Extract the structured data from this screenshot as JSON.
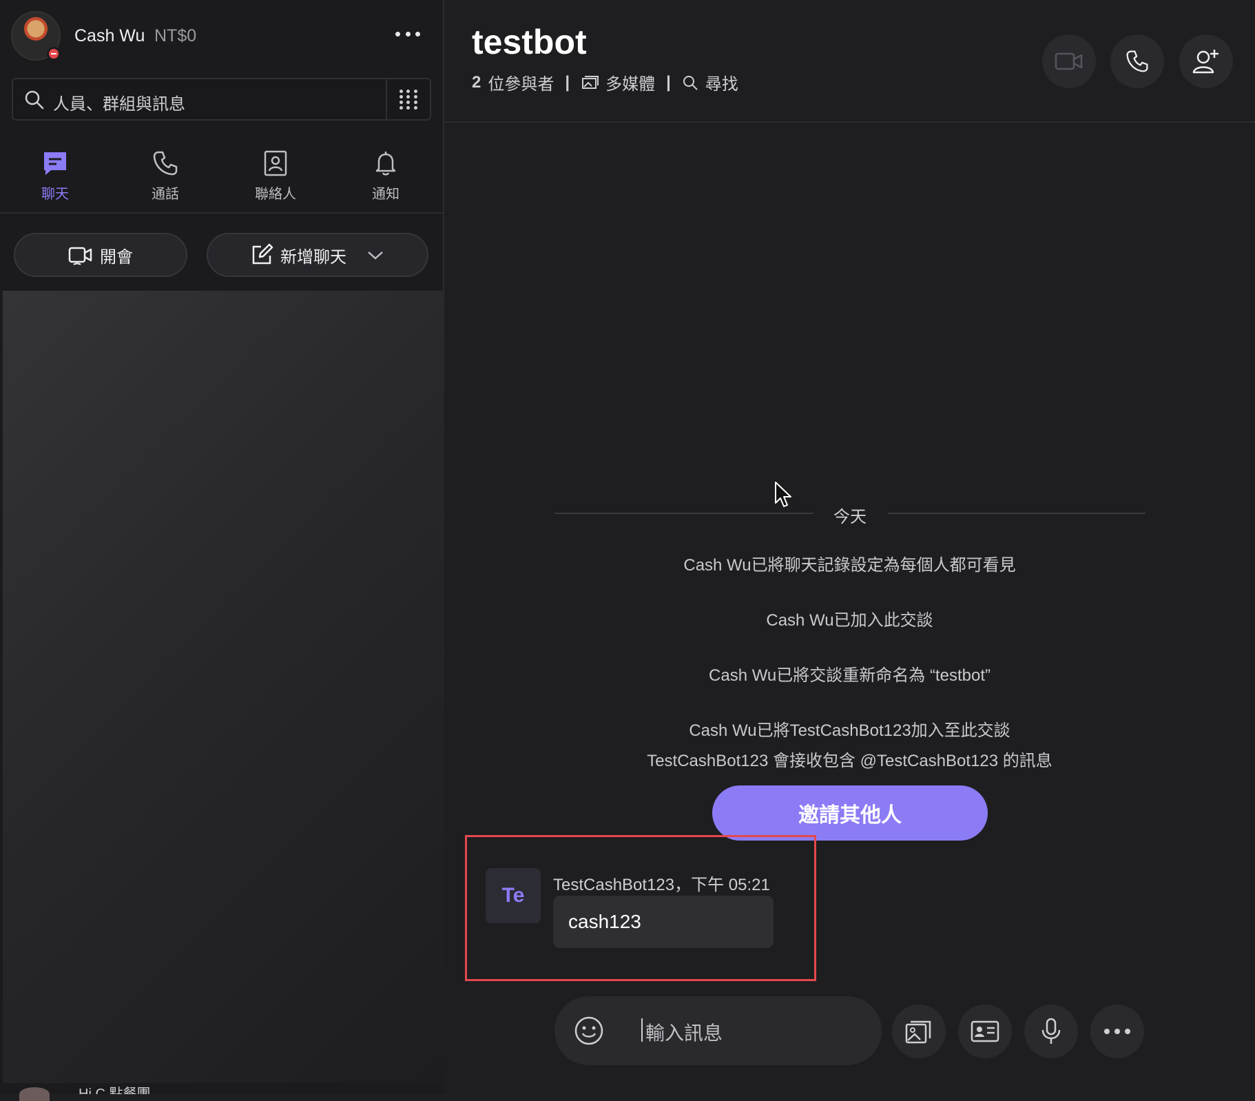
{
  "profile": {
    "name": "Cash Wu",
    "balance": "NT$0",
    "status": "do-not-disturb"
  },
  "search": {
    "placeholder": "人員、群組與訊息"
  },
  "nav": {
    "items": [
      {
        "label": "聊天",
        "icon": "chat-icon",
        "active": true
      },
      {
        "label": "通話",
        "icon": "phone-icon",
        "active": false
      },
      {
        "label": "聯絡人",
        "icon": "contacts-icon",
        "active": false
      },
      {
        "label": "通知",
        "icon": "bell-icon",
        "active": false
      }
    ]
  },
  "actions": {
    "meet_label": "開會",
    "new_chat_label": "新增聊天"
  },
  "chat_list": {
    "peek_item": "Hi C 點餐團"
  },
  "chat": {
    "title": "testbot",
    "participants_count": "2",
    "participants_label": "位參與者",
    "media_label": "多媒體",
    "find_label": "尋找"
  },
  "messages": {
    "date_divider": "今天",
    "system": [
      "Cash Wu已將聊天記錄設定為每個人都可看見",
      "Cash Wu已加入此交談",
      "Cash Wu已將交談重新命名為 “testbot”",
      "Cash Wu已將TestCashBot123加入至此交談",
      "TestCashBot123 會接收包含 @TestCashBot123 的訊息"
    ],
    "invite_label": "邀請其他人",
    "bot_message": {
      "avatar_initials": "Te",
      "meta": "TestCashBot123，下午 05:21",
      "text": "cash123"
    }
  },
  "composer": {
    "placeholder": "輸入訊息"
  },
  "colors": {
    "accent": "#8b7cf6",
    "highlight": "#e5484d",
    "background": "#1e1e20",
    "sidebar": "#1b1b1d"
  }
}
